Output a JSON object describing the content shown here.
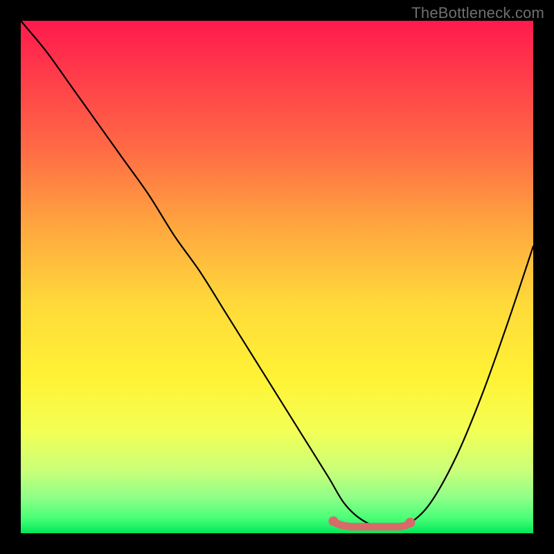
{
  "watermark": "TheBottleneck.com",
  "chart_data": {
    "type": "line",
    "title": "",
    "xlabel": "",
    "ylabel": "",
    "xlim": [
      0,
      100
    ],
    "ylim": [
      0,
      100
    ],
    "series": [
      {
        "name": "bottleneck-curve",
        "x": [
          0,
          5,
          10,
          15,
          20,
          25,
          30,
          35,
          40,
          45,
          50,
          55,
          60,
          63,
          66,
          70,
          73,
          76,
          80,
          85,
          90,
          95,
          100
        ],
        "y": [
          100,
          94,
          87,
          80,
          73,
          66,
          58,
          51,
          43,
          35,
          27,
          19,
          11,
          6,
          3,
          1,
          1,
          2,
          6,
          15,
          27,
          41,
          56
        ]
      }
    ],
    "highlight": {
      "name": "optimal-range",
      "x_start": 61,
      "x_end": 76,
      "y": 1
    },
    "gradient_stops": [
      {
        "pos": 0,
        "color": "#ff1a4d"
      },
      {
        "pos": 25,
        "color": "#ff6a45"
      },
      {
        "pos": 55,
        "color": "#ffd93a"
      },
      {
        "pos": 80,
        "color": "#f3ff55"
      },
      {
        "pos": 100,
        "color": "#00e85a"
      }
    ]
  }
}
